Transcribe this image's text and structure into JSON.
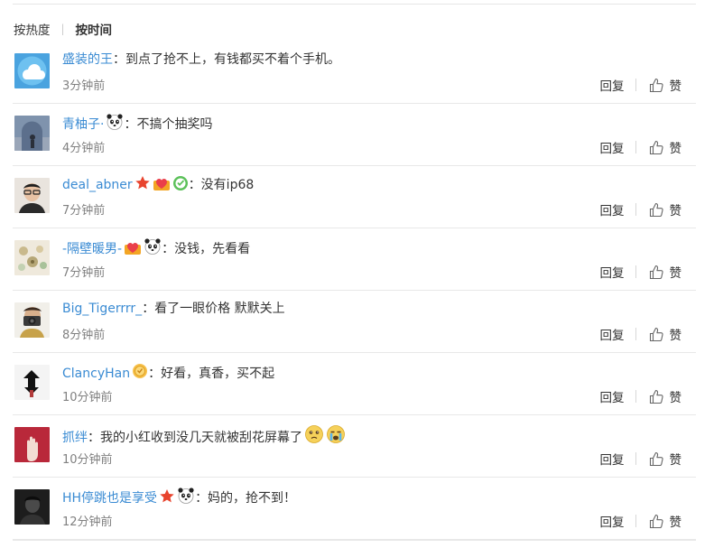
{
  "sort": {
    "hot": "按热度",
    "time": "按时间",
    "active": "time"
  },
  "comments": [
    {
      "name": "盛装的王",
      "badges": [],
      "text": "：到点了抢不上，有钱都买不着个手机。",
      "time": "3分钟前",
      "avatar": "cloud"
    },
    {
      "name": "青柚子·",
      "badges": [
        "panda-emoji"
      ],
      "text": "：不搞个抽奖吗",
      "time": "4分钟前",
      "avatar": "arch"
    },
    {
      "name": "deal_abner",
      "badges": [
        "star-badge",
        "heart-badge",
        "green-badge"
      ],
      "text": "：没有ip68",
      "time": "7分钟前",
      "avatar": "person-glasses"
    },
    {
      "name": "-隔壁暖男-",
      "badges": [
        "heart-badge",
        "panda-emoji"
      ],
      "text": "：没钱，先看看",
      "time": "7分钟前",
      "avatar": "flowers"
    },
    {
      "name": "Big_Tigerrrr_",
      "badges": [],
      "text": "：看了一眼价格 默默关上",
      "time": "8分钟前",
      "avatar": "camera-person"
    },
    {
      "name": "ClancyHan",
      "badges": [
        "gold-badge"
      ],
      "text": "：好看，真香，买不起",
      "time": "10分钟前",
      "avatar": "figure-black"
    },
    {
      "name": "抓绊",
      "badges": [],
      "text": "：我的小红收到没几天就被刮花屏幕了",
      "trailing": [
        "sad-emoji",
        "cry-emoji"
      ],
      "time": "10分钟前",
      "avatar": "hand-red"
    },
    {
      "name": "HH停跳也是享受",
      "badges": [
        "star-badge",
        "panda-emoji"
      ],
      "text": "：妈的，抢不到！",
      "time": "12分钟前",
      "avatar": "dark-person"
    }
  ],
  "actions": {
    "reply": "回复",
    "like": "赞"
  },
  "colors": {
    "name": "#3a8bd3",
    "text": "#333333",
    "time": "#808080",
    "divider": "#e8e8e8"
  }
}
